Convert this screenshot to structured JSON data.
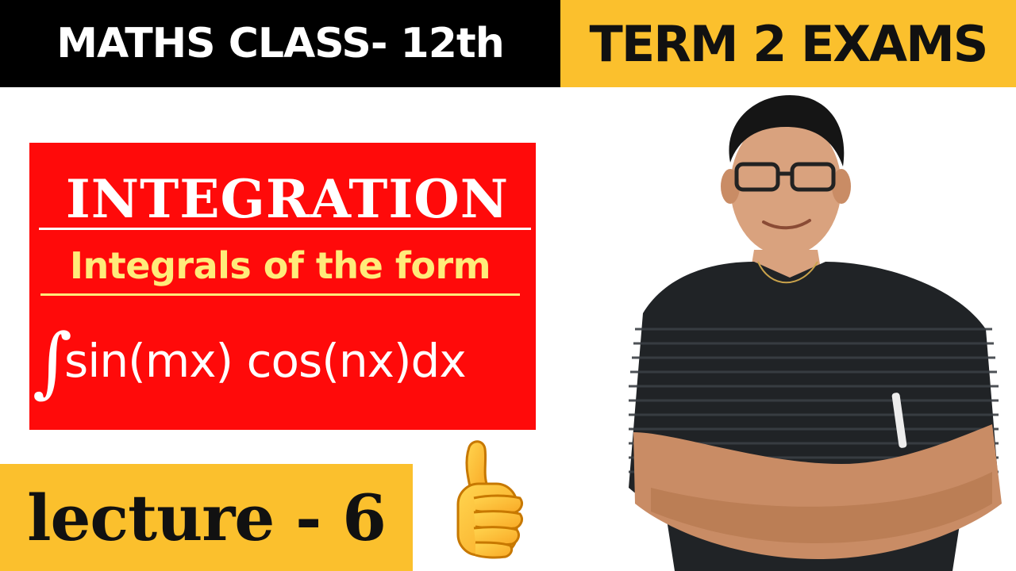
{
  "header": {
    "left_label": "MATHS CLASS- 12th",
    "right_label": "TERM 2 EXAMS"
  },
  "card": {
    "title": "INTEGRATION",
    "subtitle": "Integrals of the form",
    "integral_symbol": "∫",
    "formula": "sin(mx) cos(nx)dx"
  },
  "lecture": {
    "label": "lecture - 6"
  },
  "icons": {
    "thumb": "thumbs-up-icon",
    "presenter": "presenter-photo"
  },
  "colors": {
    "header_left_bg": "#000000",
    "accent_yellow": "#fbc02d",
    "card_red": "#ff0a0a",
    "subtitle_yellow": "#ffeb7a"
  }
}
